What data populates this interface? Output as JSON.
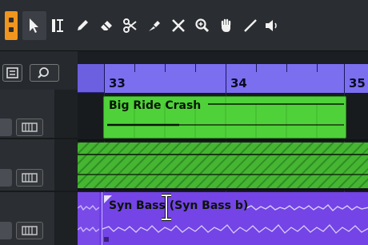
{
  "toolbar": {
    "tools": [
      {
        "name": "object-selection-icon"
      },
      {
        "name": "range-selection-icon"
      },
      {
        "name": "draw-icon"
      },
      {
        "name": "erase-icon"
      },
      {
        "name": "split-icon"
      },
      {
        "name": "glue-icon"
      },
      {
        "name": "mute-icon"
      },
      {
        "name": "zoom-icon"
      },
      {
        "name": "hand-icon"
      },
      {
        "name": "line-icon"
      },
      {
        "name": "play-icon"
      }
    ],
    "active_tool": "object-selection-icon",
    "accent": "#f0961e"
  },
  "ruler": {
    "bars": [
      "33",
      "34",
      "35"
    ]
  },
  "events": [
    {
      "title": "Big Ride Crash",
      "color": "#4fd13a"
    },
    {
      "title": "",
      "color": "#45b532"
    },
    {
      "title": "Syn Bass (Syn Bass b)",
      "color": "#7444e6"
    }
  ],
  "colors": {
    "ruler": "#6c5fe0",
    "midi_part": "#4fd13a",
    "audio_event": "#7444e6"
  }
}
